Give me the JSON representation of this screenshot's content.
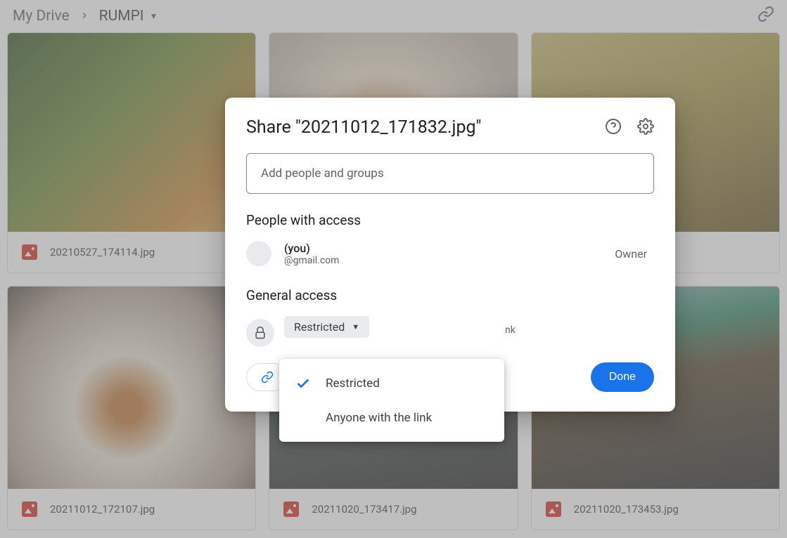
{
  "breadcrumb": {
    "root": "My Drive",
    "current": "RUMPI"
  },
  "files": [
    {
      "name": "20210527_174114.jpg"
    },
    {
      "name": ""
    },
    {
      "name": ""
    },
    {
      "name": "20211012_172107.jpg"
    },
    {
      "name": "20211020_173417.jpg"
    },
    {
      "name": "20211020_173453.jpg"
    }
  ],
  "dialog": {
    "title": "Share \"20211012_171832.jpg\"",
    "add_placeholder": "Add people and groups",
    "people_section": "People with access",
    "person": {
      "name": "(you)",
      "email": "@gmail.com",
      "role": "Owner"
    },
    "general_section": "General access",
    "access_chip": "Restricted",
    "access_desc_tail": "nk",
    "copy_link": "Copy link",
    "done": "Done"
  },
  "menu": {
    "option1": "Restricted",
    "option2": "Anyone with the link"
  }
}
